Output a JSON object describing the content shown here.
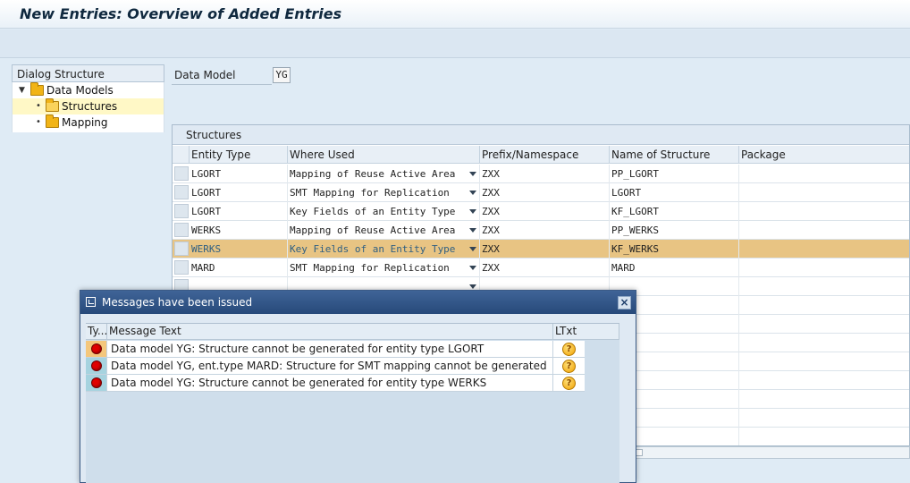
{
  "window": {
    "title": "New Entries: Overview of Added Entries"
  },
  "dialog_structure": {
    "header": "Dialog Structure",
    "items": [
      {
        "label": "Data Models",
        "toggle": "▼",
        "icon": "folder-icon"
      },
      {
        "label": "Structures",
        "bullet": "•",
        "icon": "folder-open-icon",
        "selected": true
      },
      {
        "label": "Mapping",
        "bullet": "•",
        "icon": "folder-icon"
      }
    ]
  },
  "data_model": {
    "label": "Data Model",
    "value": "YG"
  },
  "structures": {
    "title": "Structures",
    "columns": [
      "Entity Type",
      "Where Used",
      "Prefix/Namespace",
      "Name of Structure",
      "Package"
    ],
    "rows": [
      {
        "entity_type": "LGORT",
        "where_used": "Mapping of Reuse Active Area",
        "prefix": "ZXX",
        "structure": "PP_LGORT",
        "package": ""
      },
      {
        "entity_type": "LGORT",
        "where_used": "SMT Mapping for Replication",
        "prefix": "ZXX",
        "structure": "LGORT",
        "package": ""
      },
      {
        "entity_type": "LGORT",
        "where_used": "Key Fields of an Entity Type",
        "prefix": "ZXX",
        "structure": "KF_LGORT",
        "package": ""
      },
      {
        "entity_type": "WERKS",
        "where_used": "Mapping of Reuse Active Area",
        "prefix": "ZXX",
        "structure": "PP_WERKS",
        "package": ""
      },
      {
        "entity_type": "WERKS",
        "where_used": "Key Fields of an Entity Type",
        "prefix": "ZXX",
        "structure": "KF_WERKS",
        "package": "",
        "highlighted": true
      },
      {
        "entity_type": "MARD",
        "where_used": "SMT Mapping for Replication",
        "prefix": "ZXX",
        "structure": "MARD",
        "package": ""
      },
      {
        "entity_type": "",
        "where_used": "",
        "prefix": "",
        "structure": "",
        "package": ""
      }
    ]
  },
  "messages_dialog": {
    "title": "Messages have been issued",
    "close_icon": "close-icon",
    "columns": {
      "type": "Ty...",
      "text": "Message Text",
      "ltxt": "LTxt"
    },
    "messages": [
      {
        "type": "error",
        "text": "Data model YG: Structure cannot be generated for entity type LGORT"
      },
      {
        "type": "error",
        "text": "Data model YG, ent.type MARD: Structure for SMT mapping cannot be generated"
      },
      {
        "type": "error",
        "text": "Data model YG: Structure cannot be generated for entity type WERKS"
      }
    ]
  },
  "colors": {
    "highlight_row": "#e8c483",
    "dialog_titlebar": "#2f5283",
    "error": "#e00000"
  }
}
